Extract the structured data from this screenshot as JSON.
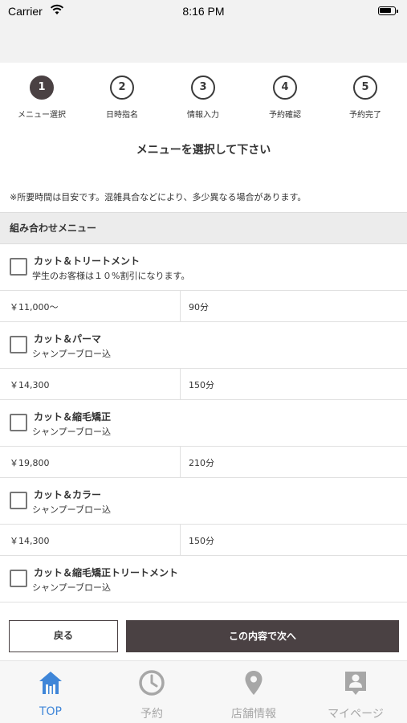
{
  "status_bar": {
    "carrier": "Carrier",
    "time": "8:16 PM"
  },
  "steps": [
    {
      "number": "1",
      "label": "メニュー選択"
    },
    {
      "number": "2",
      "label": "日時指名"
    },
    {
      "number": "3",
      "label": "情報入力"
    },
    {
      "number": "4",
      "label": "予約確認"
    },
    {
      "number": "5",
      "label": "予約完了"
    }
  ],
  "active_step": 1,
  "page_title": "メニューを選択して下さい",
  "notice": "※所要時間は目安です。混雑具合などにより、多少異なる場合があります。",
  "section_title": "組み合わせメニュー",
  "menus": [
    {
      "name": "カット＆トリートメント",
      "note": "学生のお客様は１０%割引になります。",
      "price": "￥11,000〜",
      "duration": "90分"
    },
    {
      "name": "カット＆パーマ",
      "note": "シャンプーブロー込",
      "price": "￥14,300",
      "duration": "150分"
    },
    {
      "name": "カット＆縮毛矯正",
      "note": "シャンプーブロー込",
      "price": "￥19,800",
      "duration": "210分"
    },
    {
      "name": "カット＆カラー",
      "note": "シャンプーブロー込",
      "price": "￥14,300",
      "duration": "150分"
    },
    {
      "name": "カット＆縮毛矯正トリートメント",
      "note": "シャンプーブロー込",
      "price": "",
      "duration": ""
    }
  ],
  "buttons": {
    "back": "戻る",
    "next": "この内容で次へ"
  },
  "tabs": [
    {
      "label": "TOP",
      "icon": "home-icon",
      "active": true
    },
    {
      "label": "予約",
      "icon": "clock-icon",
      "active": false
    },
    {
      "label": "店舗情報",
      "icon": "location-pin-icon",
      "active": false
    },
    {
      "label": "マイページ",
      "icon": "profile-badge-icon",
      "active": false
    }
  ],
  "colors": {
    "accent": "#4a4143",
    "tab_active": "#3f86d8",
    "tab_inactive": "#a7a7a7"
  }
}
